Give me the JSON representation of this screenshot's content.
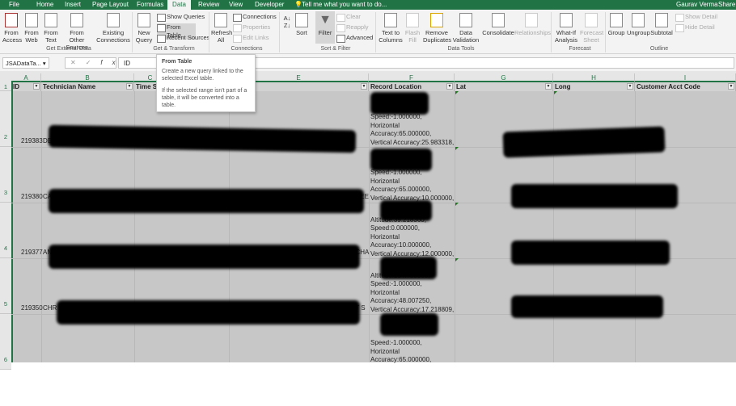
{
  "tabs": [
    "File",
    "Home",
    "Insert",
    "Page Layout",
    "Formulas",
    "Data",
    "Review",
    "View",
    "Developer"
  ],
  "tell_me": "Tell me what you want to do...",
  "user": "Gaurav Verma",
  "share": "Share",
  "ribbon": {
    "get_external": {
      "label": "Get External Data",
      "from_access": "From Access",
      "from_web": "From Web",
      "from_text": "From Text",
      "from_other": "From Other Sources",
      "existing": "Existing Connections"
    },
    "get_transform": {
      "label": "Get & Transform",
      "new_query": "New Query",
      "show_queries": "Show Queries",
      "from_table": "From Table",
      "recent_sources": "Recent Sources"
    },
    "connections": {
      "label": "Connections",
      "refresh": "Refresh All",
      "connections": "Connections",
      "properties": "Properties",
      "edit_links": "Edit Links"
    },
    "sort_filter": {
      "label": "Sort & Filter",
      "sort": "Sort",
      "filter": "Filter",
      "clear": "Clear",
      "reapply": "Reapply",
      "advanced": "Advanced"
    },
    "data_tools": {
      "label": "Data Tools",
      "text_to_columns": "Text to Columns",
      "flash_fill": "Flash Fill",
      "remove_duplicates": "Remove Duplicates",
      "data_validation": "Data Validation",
      "consolidate": "Consolidate",
      "relationships": "Relationships"
    },
    "forecast": {
      "label": "Forecast",
      "what_if": "What-If Analysis",
      "forecast_sheet": "Forecast Sheet"
    },
    "outline": {
      "label": "Outline",
      "group": "Group",
      "ungroup": "Ungroup",
      "subtotal": "Subtotal",
      "show_detail": "Show Detail",
      "hide_detail": "Hide Detail"
    }
  },
  "name_box": "JSADataTa...",
  "formula": "ID",
  "tooltip": {
    "title": "From Table",
    "line1": "Create a new query linked to the selected Excel table.",
    "line2": "If the selected range isn't part of a table, it will be converted into a table."
  },
  "columns": [
    "A",
    "B",
    "C",
    "E",
    "F",
    "G",
    "H",
    "I"
  ],
  "headers": [
    "ID",
    "Technician Name",
    "Time St",
    "Record Location",
    "Lat",
    "Long",
    "Customer Acct Code"
  ],
  "rows": [
    {
      "num": "2",
      "id": "219383",
      "name": "DEA",
      "overflow": "",
      "loc": [
        "Speed:-1.000000,",
        "Horizontal",
        "Accuracy:65.000000,",
        "Vertical Accuracy:25.983318,"
      ]
    },
    {
      "num": "3",
      "id": "219380",
      "name": "CA",
      "overflow": "REE",
      "loc": [
        "Speed:-1.000000,",
        "Horizontal",
        "Accuracy:65.000000,",
        "Vertical Accuracy:10.000000,"
      ]
    },
    {
      "num": "4",
      "id": "219377",
      "name": "AND",
      "overflow": "CHA",
      "loc": [
        "Altitude:39.218360,",
        "Speed:0.000000,",
        "Horizontal",
        "Accuracy:10.000000,",
        "Vertical Accuracy:12.000000,"
      ]
    },
    {
      "num": "5",
      "id": "219350",
      "name": "CHR",
      "overflow": "ST S",
      "loc": [
        "Altitude:154.758365,",
        "Speed:-1.000000,",
        "Horizontal",
        "Accuracy:48.007250,",
        "Vertical Accuracy:17.218809,"
      ]
    },
    {
      "num": "6",
      "loc": [
        "Speed:-1.000000,",
        "Horizontal",
        "Accuracy:65.000000,"
      ]
    }
  ],
  "row1": "1"
}
